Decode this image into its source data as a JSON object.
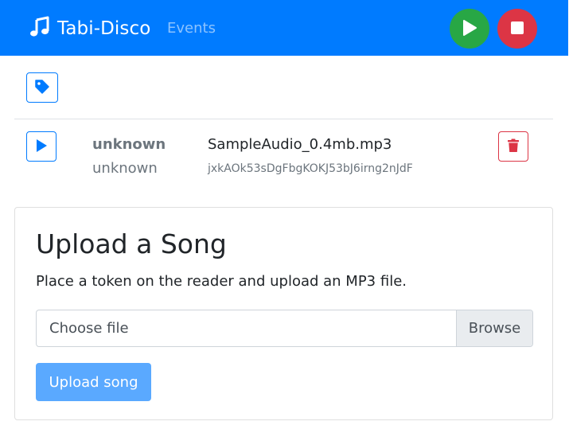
{
  "navbar": {
    "brand": "Tabi-Disco",
    "brand_icon": "music-note-icon",
    "events_link": "Events",
    "play_icon": "play-icon",
    "stop_icon": "stop-icon",
    "colors": {
      "background": "#007bff",
      "play": "#28a745",
      "stop": "#dc3545"
    }
  },
  "toolbar": {
    "tag_icon": "tag-icon"
  },
  "songs": [
    {
      "artist": "unknown",
      "album": "unknown",
      "filename": "SampleAudio_0.4mb.mp3",
      "token": "jxkAOk53sDgFbgKOKJ53bJ6irng2nJdF"
    }
  ],
  "upload": {
    "title": "Upload a Song",
    "description": "Place a token on the reader and upload an MP3 file.",
    "file_placeholder": "Choose file",
    "browse_label": "Browse",
    "submit_label": "Upload song"
  }
}
